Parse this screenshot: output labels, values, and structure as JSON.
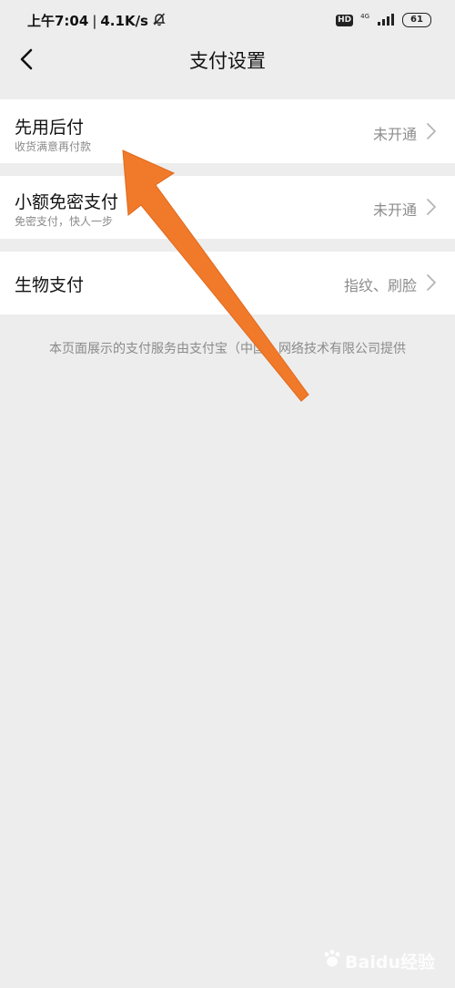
{
  "status_bar": {
    "time": "上午7:04",
    "speed": "4.1K/s",
    "hd": "HD",
    "network": "4G",
    "battery": "61"
  },
  "nav": {
    "title": "支付设置"
  },
  "settings": [
    {
      "title": "先用后付",
      "subtitle": "收货满意再付款",
      "value": "未开通"
    },
    {
      "title": "小额免密支付",
      "subtitle": "免密支付，快人一步",
      "value": "未开通"
    },
    {
      "title": "生物支付",
      "value": "指纹、刷脸"
    }
  ],
  "footer": {
    "note": "本页面展示的支付服务由支付宝（中国）网络技术有限公司提供"
  },
  "watermark": {
    "text": "Baidu经验"
  },
  "colors": {
    "background": "#ededed",
    "arrow": "#f07a2a"
  }
}
